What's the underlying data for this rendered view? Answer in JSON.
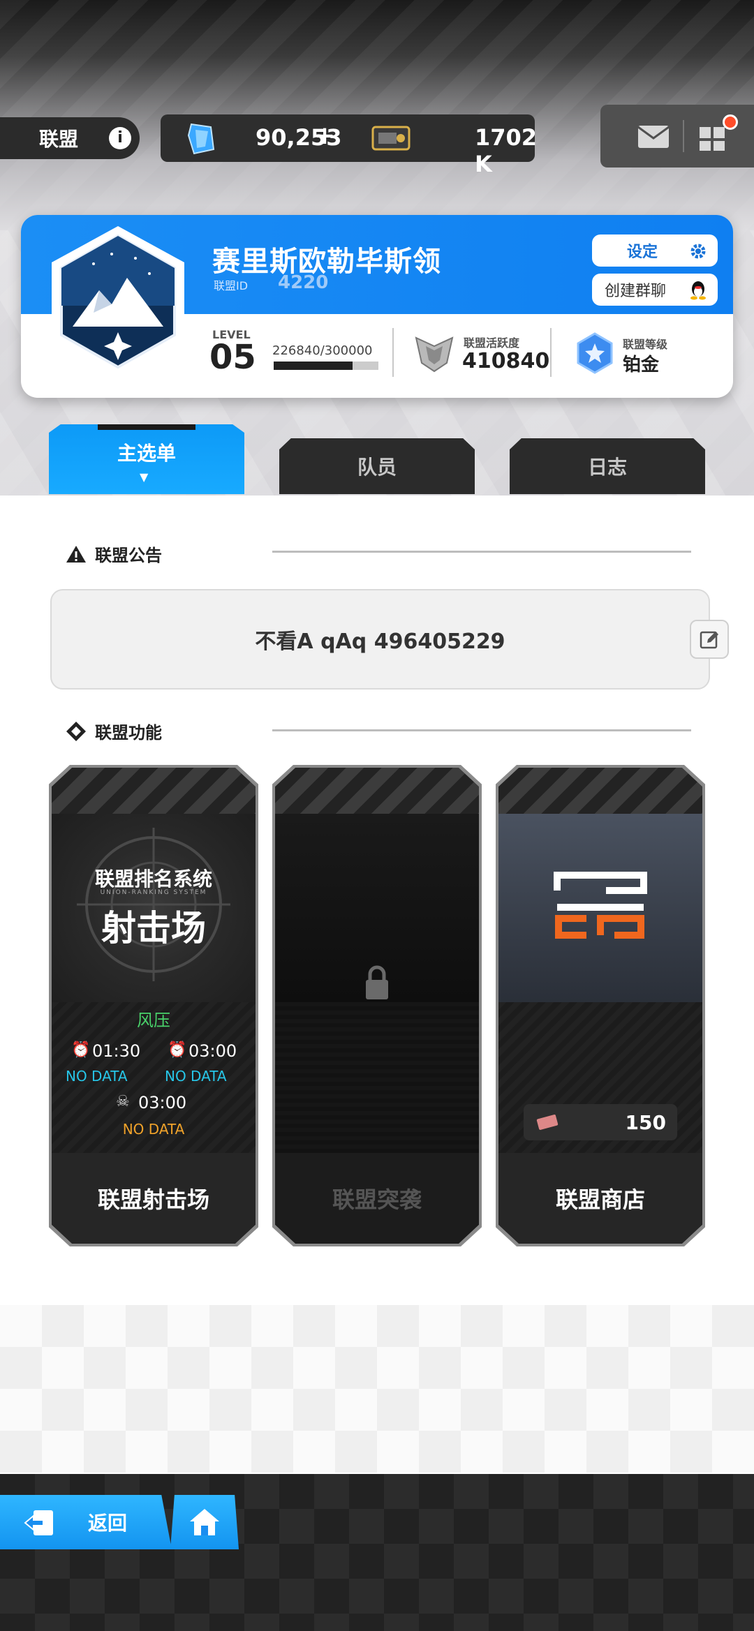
{
  "header": {
    "title": "联盟",
    "info_icon": "info-icon",
    "crystal_amount": "90,253",
    "add_label": "+",
    "ticket_amount": "1702 K"
  },
  "guild": {
    "name": "赛里斯欧勒毕斯领",
    "id_label": "联盟ID",
    "id": "4220",
    "settings_label": "设定",
    "group_chat_label": "创建群聊",
    "level_label": "LEVEL",
    "level": "05",
    "exp_text": "226840/300000",
    "exp_fraction": 0.756,
    "activity_label": "联盟活跃度",
    "activity": "410840",
    "rank_label": "联盟等级",
    "rank": "铂金"
  },
  "tabs": [
    {
      "label": "主选单",
      "active": true
    },
    {
      "label": "队员",
      "active": false
    },
    {
      "label": "日志",
      "active": false
    }
  ],
  "notice": {
    "section_title": "联盟公告",
    "text": "不看A qAq 496405229"
  },
  "features": {
    "section_title": "联盟功能",
    "cards": [
      {
        "name": "联盟射击场",
        "banner_title": "联盟排名系统",
        "banner_sub": "UNION-RANKING SYSTEM",
        "banner_big": "射击场",
        "mode": "风压",
        "time1": "01:30",
        "time2": "03:00",
        "nodata1": "NO DATA",
        "nodata2": "NO DATA",
        "time3": "03:00",
        "nodata3": "NO DATA"
      },
      {
        "name": "联盟突袭",
        "locked": true
      },
      {
        "name": "联盟商店",
        "price": "150"
      }
    ]
  },
  "nav": {
    "back_label": "返回"
  },
  "colors": {
    "accent": "#1b8ef5",
    "green": "#49d26a",
    "cyan": "#27c6e8",
    "orange": "#f0a22a"
  }
}
